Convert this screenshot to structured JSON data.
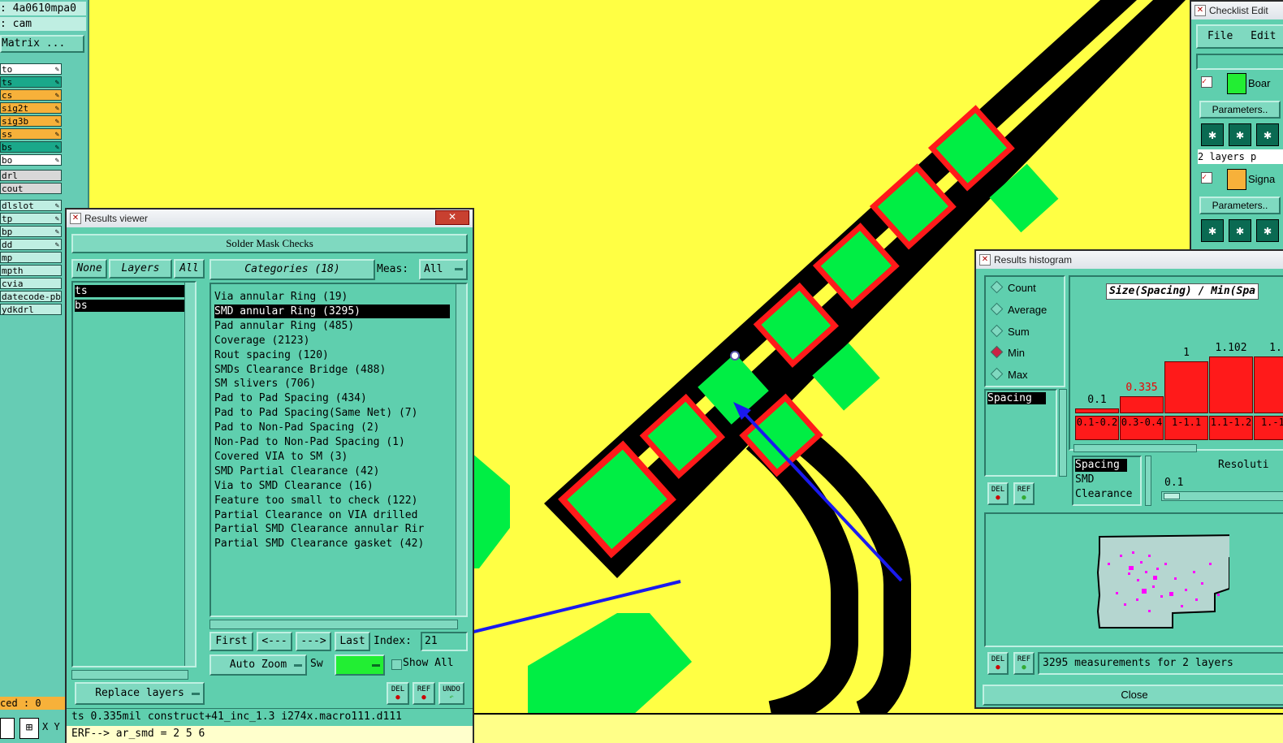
{
  "colors": {
    "canvas_bg": "#ffff44",
    "pad_green": "#00ee44",
    "pad_outline": "#ff1a1a",
    "trace": "#000000",
    "dialog_bg": "#5fcfae",
    "arrow": "#1a1aee"
  },
  "sidebar": {
    "job": ": 4a0610mpa0",
    "step": ": cam",
    "matrix_button": "Matrix ...",
    "layers": [
      {
        "name": "to",
        "color": "#ffffff"
      },
      {
        "name": "ts",
        "color": "#1aa88a"
      },
      {
        "name": "cs",
        "color": "#f7b13a"
      },
      {
        "name": "sig2t",
        "color": "#f7b13a"
      },
      {
        "name": "sig3b",
        "color": "#f7b13a"
      },
      {
        "name": "ss",
        "color": "#f7b13a"
      },
      {
        "name": "bs",
        "color": "#1aa88a"
      },
      {
        "name": "bo",
        "color": "#ffffff"
      },
      {
        "name": "drl",
        "color": "#d8d8d8"
      },
      {
        "name": "cout",
        "color": "#d8d8d8"
      },
      {
        "name": "dlslot",
        "color": "#bfeee2"
      },
      {
        "name": "tp",
        "color": "#bfeee2"
      },
      {
        "name": "bp",
        "color": "#bfeee2"
      },
      {
        "name": "dd",
        "color": "#bfeee2"
      },
      {
        "name": "mp",
        "color": "#bfeee2"
      },
      {
        "name": "mpth",
        "color": "#bfeee2"
      },
      {
        "name": "cvia",
        "color": "#bfeee2"
      },
      {
        "name": "datecode-pbo",
        "color": "#bfeee2"
      },
      {
        "name": "ydkdrl",
        "color": "#bfeee2"
      }
    ],
    "selected_counter": "ced : 0"
  },
  "results_viewer": {
    "title": "Results viewer",
    "header": "Solder Mask Checks",
    "layers_tabs": {
      "none": "None",
      "layers": "Layers",
      "all": "All"
    },
    "layers_list": [
      "ts",
      "bs"
    ],
    "categories_label": "Categories (18)",
    "meas_label": "Meas:",
    "meas_value": "All",
    "categories": [
      "Via annular Ring (19)",
      "SMD annular Ring (3295)",
      "Pad annular Ring (485)",
      "Coverage (2123)",
      "Rout spacing (120)",
      "SMDs Clearance Bridge (488)",
      "SM slivers (706)",
      "Pad to Pad Spacing (434)",
      "Pad to Pad Spacing(Same Net) (7)",
      "Pad to Non-Pad Spacing (2)",
      "Non-Pad to Non-Pad Spacing (1)",
      "Covered VIA to SM (3)",
      "SMD Partial Clearance (42)",
      "Via to SMD Clearance (16)",
      "Feature too small to check (122)",
      "Partial Clearance on VIA drilled",
      "Partial SMD Clearance annular Rir",
      "Partial SMD Clearance gasket (42)"
    ],
    "selected_category_index": 1,
    "nav": {
      "first": "First",
      "prev": "<---",
      "next": "--->",
      "last": "Last",
      "index_label": "Index:",
      "index_value": "21"
    },
    "auto_zoom": "Auto Zoom",
    "show_label": "Sw",
    "show_all": "Show All",
    "replace_layers": "Replace layers",
    "icons": [
      "DEL",
      "REF",
      "UNDO"
    ],
    "status": "ts 0.335mil   construct+41_inc_1.3   i274x.macro111.d111",
    "command": "ERF--> ar_smd = 2 5 6"
  },
  "checklist_editor": {
    "title": "Checklist Edit",
    "menu": [
      "File",
      "Edit"
    ],
    "items": [
      {
        "label": "Boar",
        "params": "Parameters..",
        "info": "2 layers p"
      },
      {
        "label": "Signa",
        "params": "Parameters..",
        "info": ""
      }
    ]
  },
  "histogram": {
    "title": "Results histogram",
    "options": [
      {
        "label": "Count",
        "checked": false
      },
      {
        "label": "Average",
        "checked": false
      },
      {
        "label": "Sum",
        "checked": false
      },
      {
        "label": "Min",
        "checked": true
      },
      {
        "label": "Max",
        "checked": false
      }
    ],
    "list_top": [
      "Spacing"
    ],
    "chart_title": "Size(Spacing) / Min(Spa",
    "list_bottom": [
      "Spacing",
      "SMD",
      "Clearance"
    ],
    "resolution_label": "Resoluti",
    "resolution_value": "0.1",
    "summary": "3295 measurements for 2 layers",
    "close": "Close",
    "icons": [
      "DEL",
      "REF"
    ]
  },
  "chart_data": {
    "type": "bar",
    "title": "Size(Spacing) / Min(Spa",
    "categories": [
      "0.1-0.2",
      "0.3-0.4",
      "1-1.1",
      "1.1-1.2",
      "1.-1."
    ],
    "values": [
      0.1,
      0.335,
      1,
      1.102,
      1.1
    ],
    "value_labels": [
      "0.1",
      "0.335",
      "1",
      "1.102",
      "1."
    ],
    "highlight_index": 1
  }
}
